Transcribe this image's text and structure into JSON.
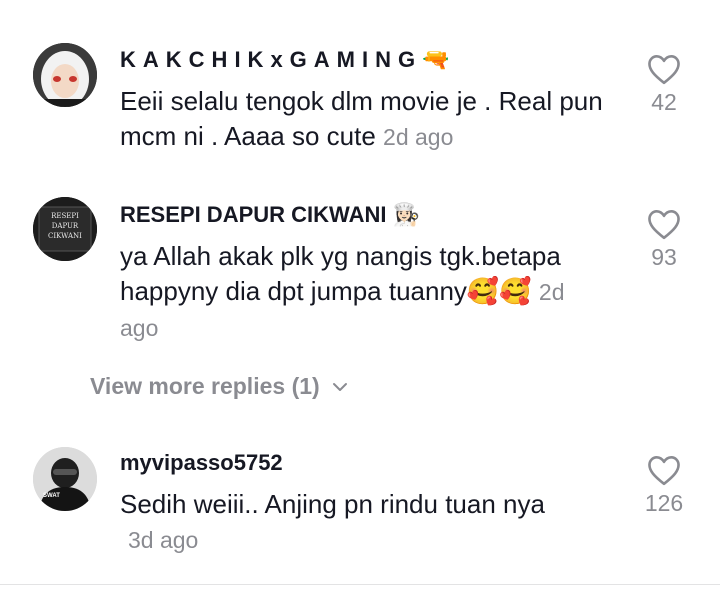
{
  "comments": [
    {
      "username": "KAKCHIKxGAMING",
      "username_suffix": "🔫",
      "text": "Eeii selalu tengok dlm movie je . Real pun mcm ni . Aaaa so cute",
      "time": "2d ago",
      "likes": "42",
      "avatar_icon": "avatar-woman-hijab"
    },
    {
      "username": "RESEPI DAPUR CIKWANI",
      "username_suffix": "👩🏻‍🍳",
      "text": "ya Allah akak plk yg nangis tgk.betapa happyny dia dpt jumpa tuanny🥰🥰",
      "time": "2d ago",
      "likes": "93",
      "avatar_lines": [
        "RESEPI",
        "DAPUR",
        "CIKWANI"
      ]
    },
    {
      "username": "myvipasso5752",
      "username_suffix": "",
      "text": "Sedih weiii.. Anjing pn rindu tuan nya",
      "time": "3d ago",
      "likes": "126",
      "avatar_label": "SWAT"
    }
  ],
  "view_more_replies": "View more replies (1)",
  "colors": {
    "text": "#161823",
    "muted": "#8a8b91"
  }
}
